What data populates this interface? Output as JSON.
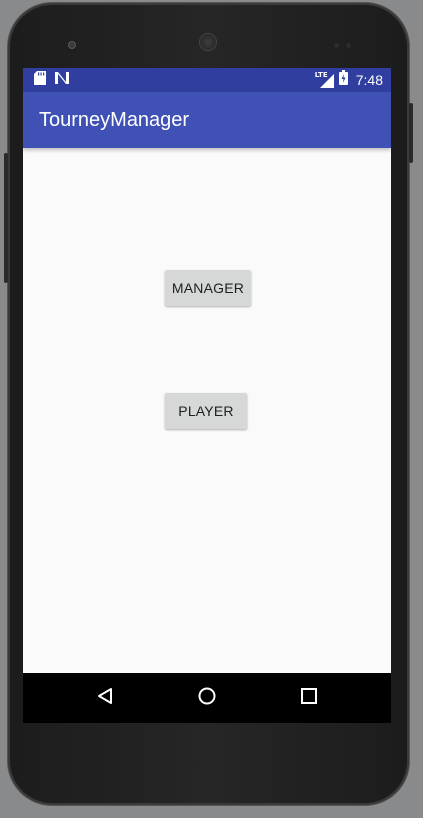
{
  "status_bar": {
    "time": "7:48",
    "network_badge": "LTE",
    "left_icons": [
      "sd-card-icon",
      "n-notification-icon"
    ],
    "right_icons": [
      "lte-signal-icon",
      "battery-icon"
    ]
  },
  "app_bar": {
    "title": "TourneyManager"
  },
  "main": {
    "manager_button_label": "MANAGER",
    "player_button_label": "PLAYER"
  },
  "nav_bar": {
    "icons": [
      "back-icon",
      "home-icon",
      "recents-icon"
    ]
  },
  "colors": {
    "status_bar": "#303f9f",
    "app_bar": "#3f51b5",
    "background": "#fafafa",
    "button": "#d6d7d7"
  }
}
